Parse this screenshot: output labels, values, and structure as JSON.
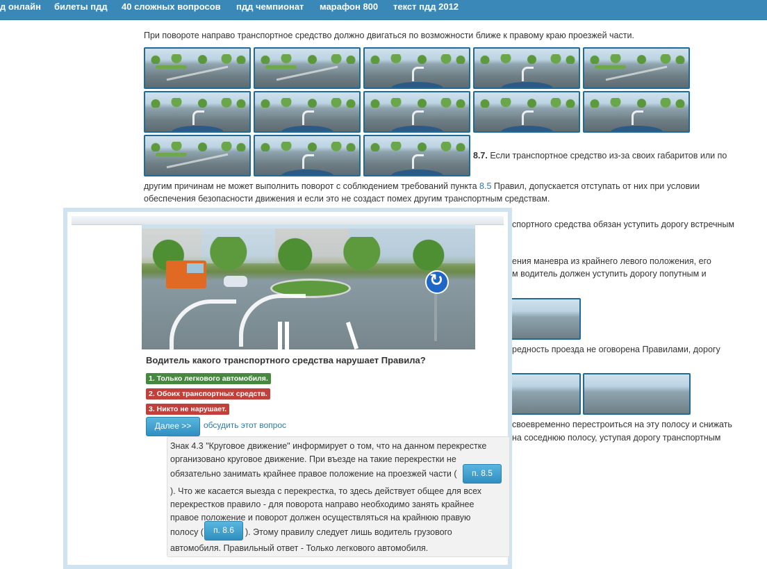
{
  "nav": {
    "items": [
      "д онлайн",
      "билеты пдд",
      "40 сложных вопросов",
      "пдд чемпионат",
      "марафон 800",
      "текст пдд 2012"
    ]
  },
  "article": {
    "intro": "При повороте направо транспортное средство должно двигаться по возможности ближе к правому краю проезжей части.",
    "p87_num": "8.7.",
    "p87_line1": " Если транспортное средство из-за своих габаритов или по",
    "p87_line2_a": "другим причинам не может выполнить поворот с соблюдением требований пункта ",
    "p87_link": "8.5",
    "p87_line2_b": " Правил, допускается отступать от них при условии",
    "p87_line3": "обеспечения безопасности движения и если это не создаст помех другим транспортным средствам.",
    "r1": "спортного средства обязан уступить дорогу встречным",
    "r2": "ения маневра из крайнего левого положения, его",
    "r3": "м водитель должен уступить дорогу попутным и",
    "r4": "редность проезда не оговорена Правилами, дорогу",
    "r5": "своевременно перестроиться на эту полосу и снижать",
    "r6": "на соседнюю полосу, уступая дорогу транспортным"
  },
  "quiz": {
    "question": "Водитель какого транспортного средства нарушает Правила?",
    "answers": [
      {
        "text": "1. Только легкового автомобиля.",
        "status": "correct"
      },
      {
        "text": "2. Обоих транспортных средств.",
        "status": "wrong"
      },
      {
        "text": "3. Никто не нарушает.",
        "status": "wrong"
      }
    ],
    "next_label": "Далее >>",
    "discuss_label": "обсудить этот вопрос",
    "explanation": {
      "l1": "Знак 4.3 \"Круговое движение\" информирует о том, что на данном перекрестке",
      "l2": "организовано круговое движение. При въезде на такие перекрестки не",
      "l3": "обязательно занимать крайнее правое положение на проезжей части (",
      "ref1": "п. 8.5",
      "l4": "). Что же касается выезда с перекрестка, то здесь действует общее для всех",
      "l5": "перекрестков правило - для поворота направо необходимо занять крайнее",
      "l6": "правое положение и поворот должен осуществляться на крайнюю правую",
      "l7a": "полосу (",
      "ref2": "п. 8.6",
      "l7b": "). Этому правилу следует лишь водитель грузового",
      "l8": "автомобиля. Правильный ответ - Только легкового автомобиля."
    }
  },
  "colors": {
    "nav_bg": "#3a88b8",
    "link": "#2a7ab0",
    "correct": "#46883f",
    "wrong": "#c0413b",
    "button": "#3a9fd0"
  }
}
